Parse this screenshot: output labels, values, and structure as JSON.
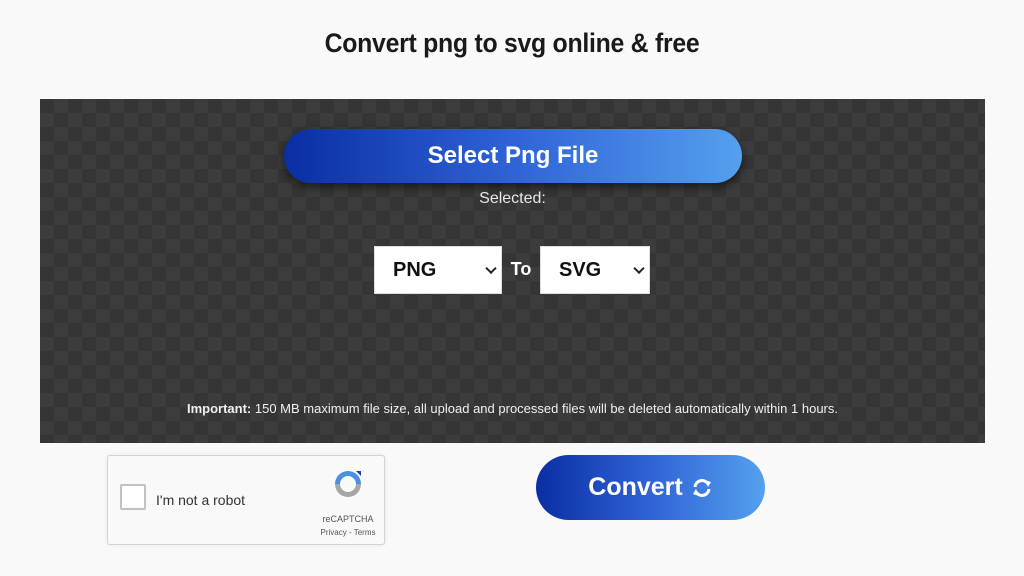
{
  "page": {
    "title": "Convert png to svg online & free"
  },
  "upload": {
    "select_button_label": "Select Png File",
    "selected_label": "Selected:",
    "from_format": "PNG",
    "to_label": "To",
    "to_format": "SVG",
    "notice_strong": "Important:",
    "notice_text": " 150 MB maximum file size, all upload and processed files will be deleted automatically within 1 hours."
  },
  "recaptcha": {
    "label": "I'm not a robot",
    "brand": "reCAPTCHA",
    "privacy": "Privacy",
    "separator": " - ",
    "terms": "Terms"
  },
  "actions": {
    "convert_label": "Convert",
    "convert_icon": "refresh-icon"
  },
  "colors": {
    "button_gradient_start": "#0a2ea3",
    "button_gradient_end": "#55a0ee",
    "dropzone_bg": "#353535"
  }
}
